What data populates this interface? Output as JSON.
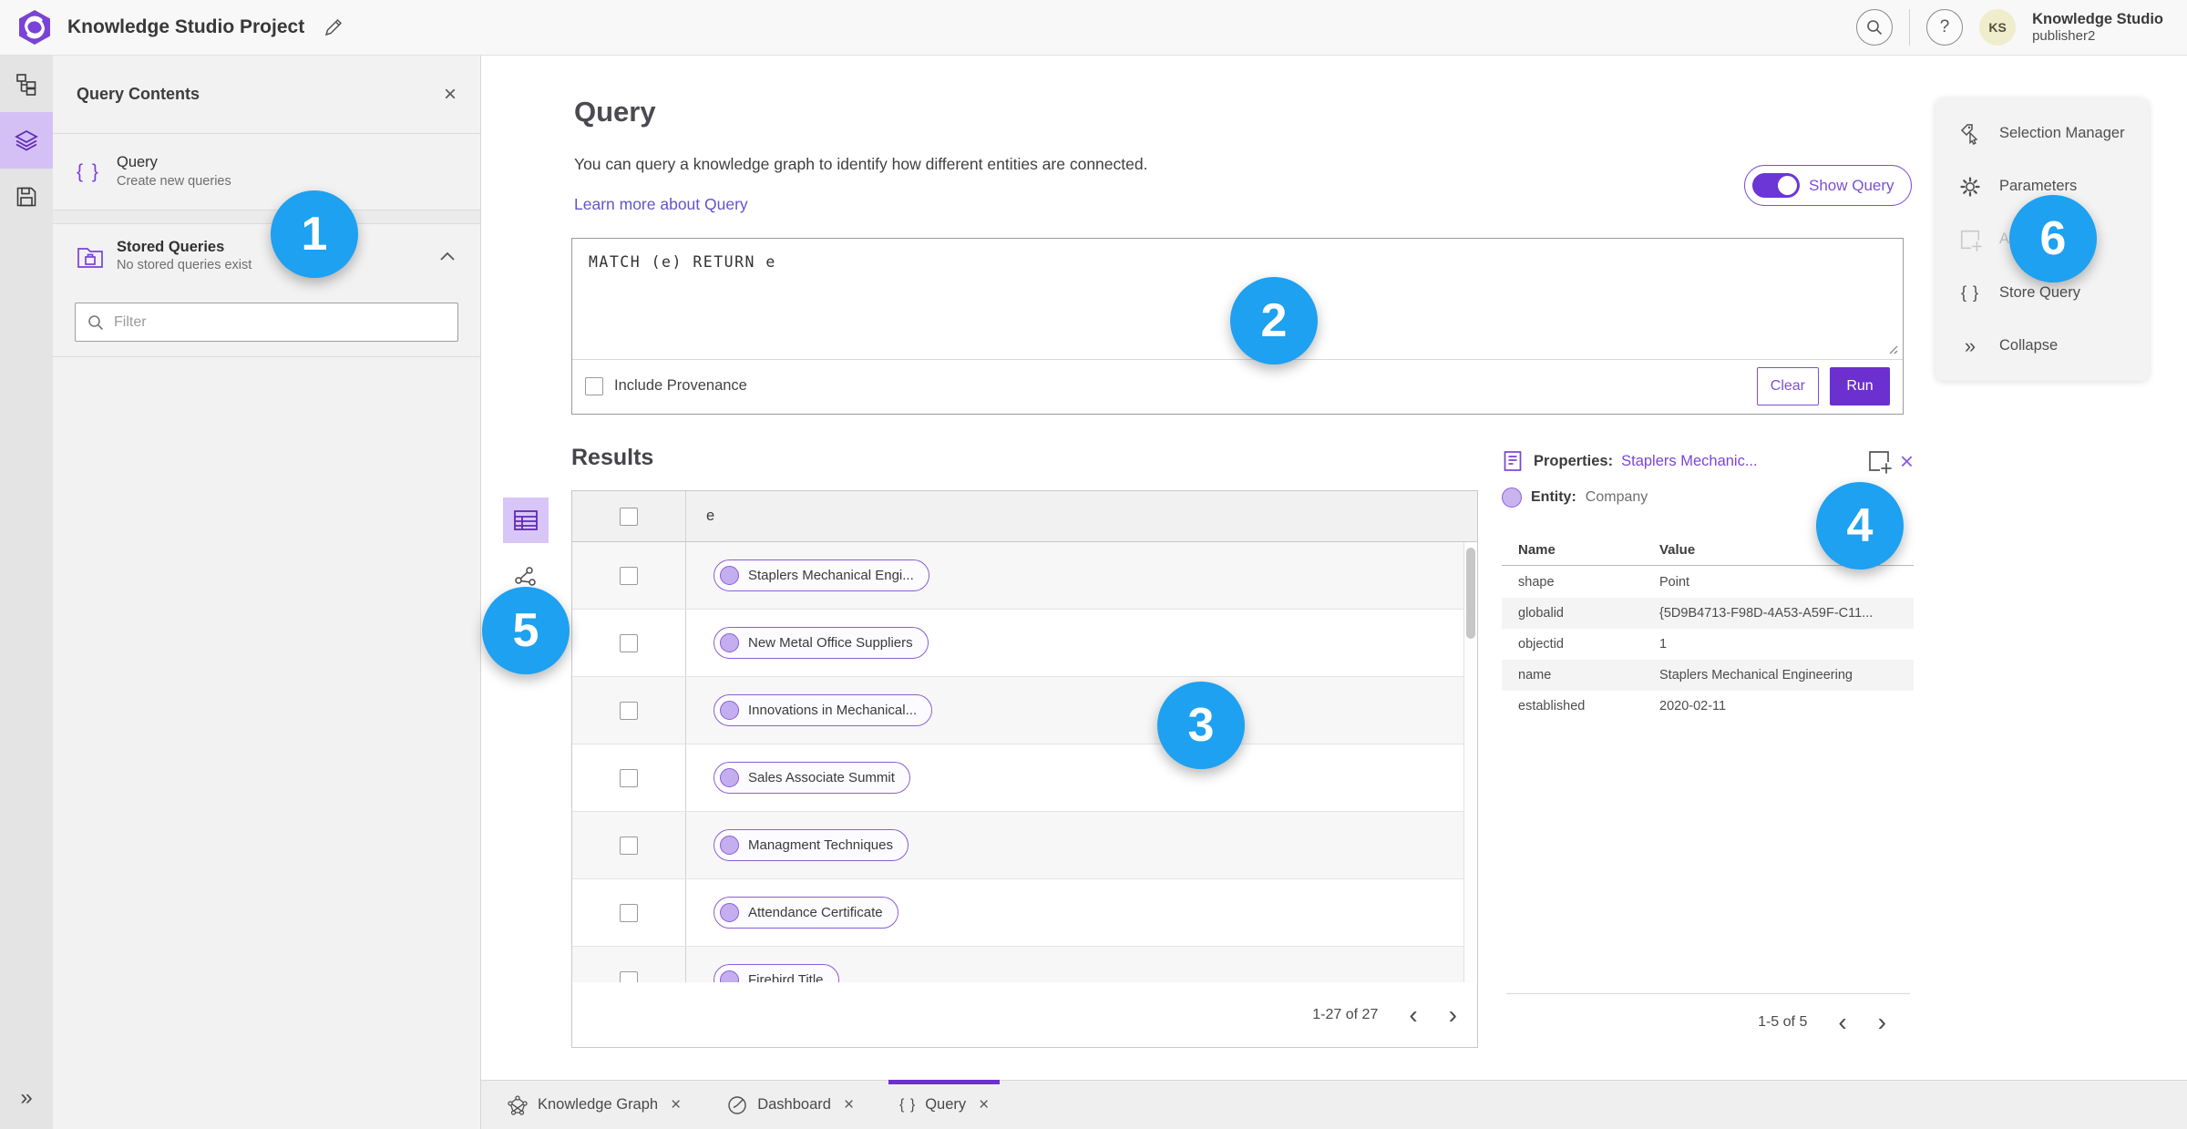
{
  "header": {
    "title": "Knowledge Studio Project",
    "user": {
      "initials": "KS",
      "name": "Knowledge Studio",
      "role": "publisher2"
    }
  },
  "contents_panel": {
    "title": "Query Contents",
    "query_item": {
      "label": "Query",
      "sublabel": "Create new queries"
    },
    "stored_item": {
      "label": "Stored Queries",
      "sublabel": "No stored queries exist"
    },
    "filter_placeholder": "Filter"
  },
  "query_section": {
    "title": "Query",
    "description": "You can query a knowledge graph to identify how different entities are connected.",
    "learn_more_label": "Learn more about Query",
    "show_query_label": "Show Query",
    "query_text": "MATCH (e) RETURN e",
    "include_provenance_label": "Include Provenance",
    "clear_label": "Clear",
    "run_label": "Run"
  },
  "results": {
    "title": "Results",
    "column_header": "e",
    "rows": [
      "Staplers Mechanical Engi...",
      "New Metal Office Suppliers",
      "Innovations in Mechanical...",
      "Sales Associate Summit",
      "Managment Techniques",
      "Attendance Certificate",
      "Firebird Title"
    ],
    "pagination": "1-27 of 27"
  },
  "properties": {
    "title_label": "Properties:",
    "title_value": "Staplers Mechanic...",
    "entity_label": "Entity:",
    "entity_value": "Company",
    "col_name": "Name",
    "col_value": "Value",
    "rows": [
      {
        "name": "shape",
        "value": "Point"
      },
      {
        "name": "globalid",
        "value": "{5D9B4713-F98D-4A53-A59F-C11..."
      },
      {
        "name": "objectid",
        "value": "1"
      },
      {
        "name": "name",
        "value": "Staplers Mechanical Engineering"
      },
      {
        "name": "established",
        "value": "2020-02-11"
      }
    ],
    "pagination": "1-5 of 5"
  },
  "right_menu": {
    "items": [
      {
        "label": "Selection Manager"
      },
      {
        "label": "Parameters"
      },
      {
        "label": "Ad"
      },
      {
        "label": "Store Query"
      },
      {
        "label": "Collapse"
      }
    ]
  },
  "bottom_tabs": [
    {
      "label": "Knowledge Graph"
    },
    {
      "label": "Dashboard"
    },
    {
      "label": "Query"
    }
  ],
  "annotations": {
    "labels": [
      "1",
      "2",
      "3",
      "4",
      "5",
      "6"
    ]
  },
  "icons": {
    "braces": "{ }",
    "close": "×",
    "help": "?",
    "chevron_left": "‹",
    "chevron_right": "›",
    "collapse": "»",
    "expand": "»"
  },
  "colors": {
    "accent_purple": "#6c2fd0",
    "purple_border": "#8a5fd6",
    "annotation_blue": "#1da1f0"
  }
}
